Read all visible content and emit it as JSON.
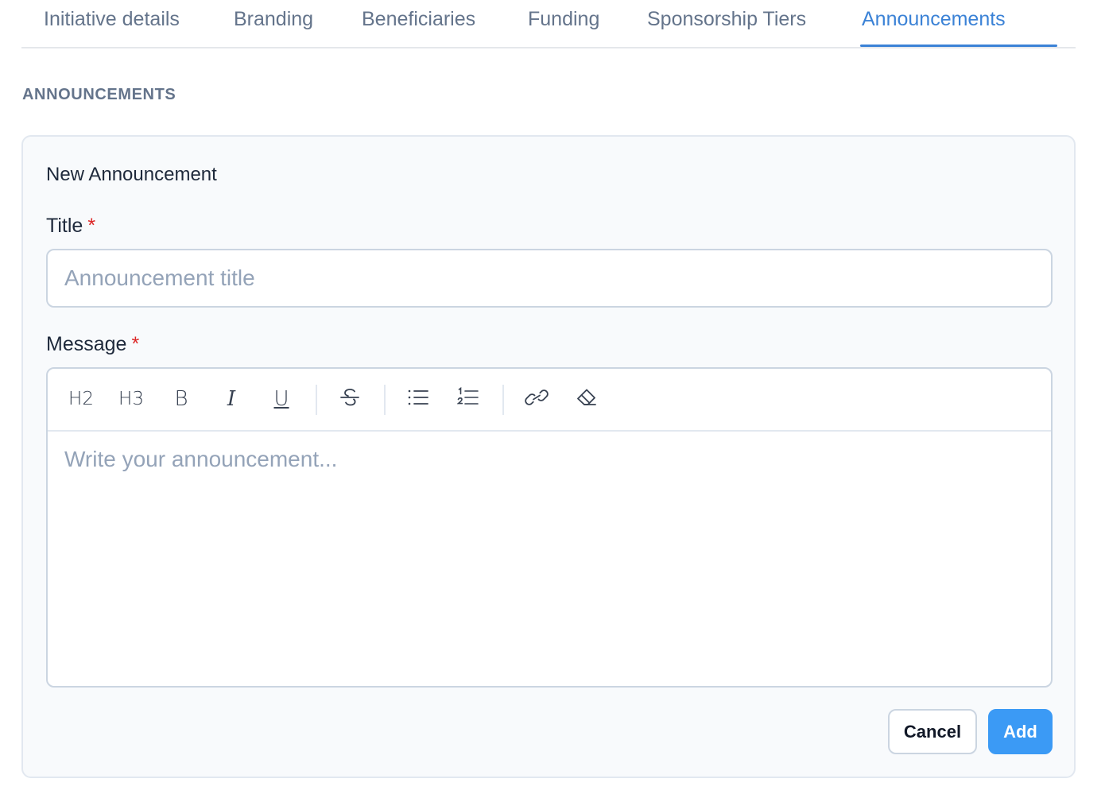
{
  "tabs": [
    {
      "label": "Initiative details"
    },
    {
      "label": "Branding"
    },
    {
      "label": "Beneficiaries"
    },
    {
      "label": "Funding"
    },
    {
      "label": "Sponsorship Tiers"
    },
    {
      "label": "Announcements",
      "active": true
    }
  ],
  "section": {
    "title": "ANNOUNCEMENTS"
  },
  "form": {
    "heading": "New Announcement",
    "title_label": "Title",
    "title_placeholder": "Announcement title",
    "message_label": "Message",
    "message_placeholder": "Write your announcement...",
    "required_marker": "*"
  },
  "toolbar": {
    "h2": "H2",
    "h3": "H3",
    "bold": "B",
    "italic": "I",
    "underline": "U"
  },
  "actions": {
    "cancel": "Cancel",
    "add": "Add"
  },
  "colors": {
    "accent": "#3b82d6",
    "primary_button": "#3b9af5",
    "required": "#dc2626"
  }
}
